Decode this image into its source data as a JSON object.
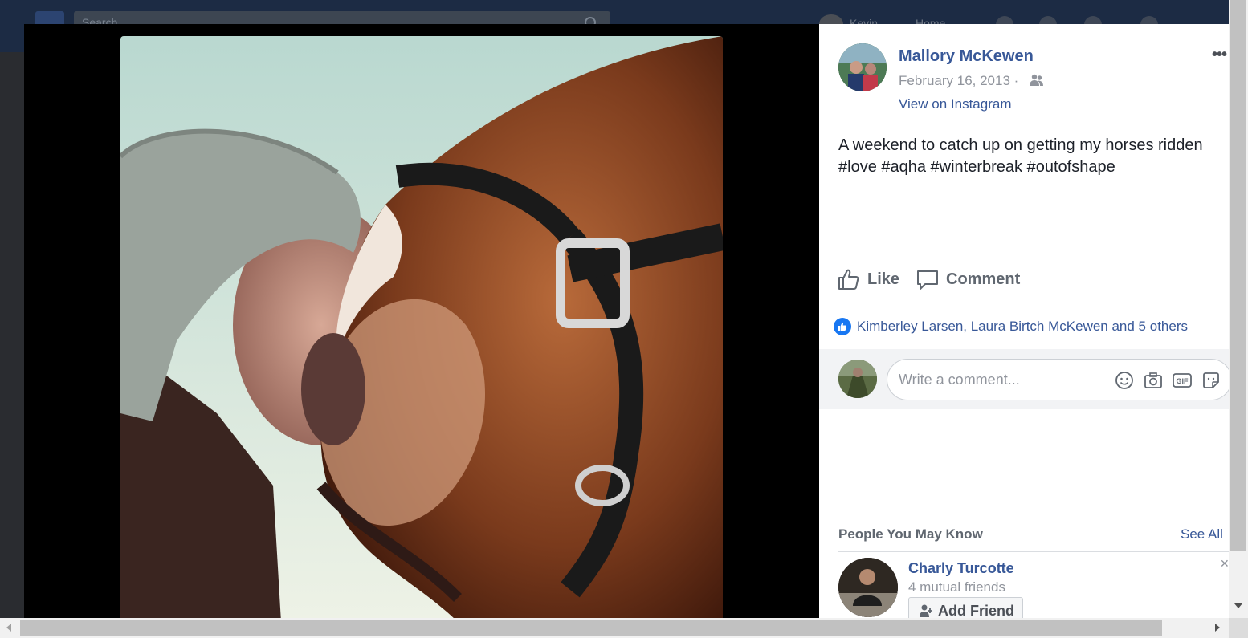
{
  "header": {
    "search_placeholder": "Search",
    "username": "Kevin",
    "home_label": "Home"
  },
  "post": {
    "author": "Mallory McKewen",
    "date": "February 16, 2013 ·",
    "audience_icon": "friends-icon",
    "view_link": "View on Instagram",
    "more_label": "•••",
    "text": "A weekend to catch up on getting my horses ridden #love #aqha #winterbreak #outofshape"
  },
  "actions": {
    "like_label": "Like",
    "comment_label": "Comment"
  },
  "reactions": {
    "summary": "Kimberley Larsen, Laura Birtch McKewen and 5 others"
  },
  "comment_input": {
    "placeholder": "Write a comment...",
    "icons": [
      "emoji-icon",
      "camera-icon",
      "gif-icon",
      "sticker-icon"
    ],
    "gif_label": "GIF"
  },
  "pymk": {
    "title": "People You May Know",
    "see_all": "See All",
    "person": {
      "name": "Charly Turcotte",
      "mutual": "4 mutual friends",
      "add_friend": "Add Friend"
    }
  },
  "colors": {
    "link_blue": "#385898",
    "like_blue": "#1877f2",
    "text_dark": "#1d2129",
    "meta_gray": "#90949c"
  }
}
